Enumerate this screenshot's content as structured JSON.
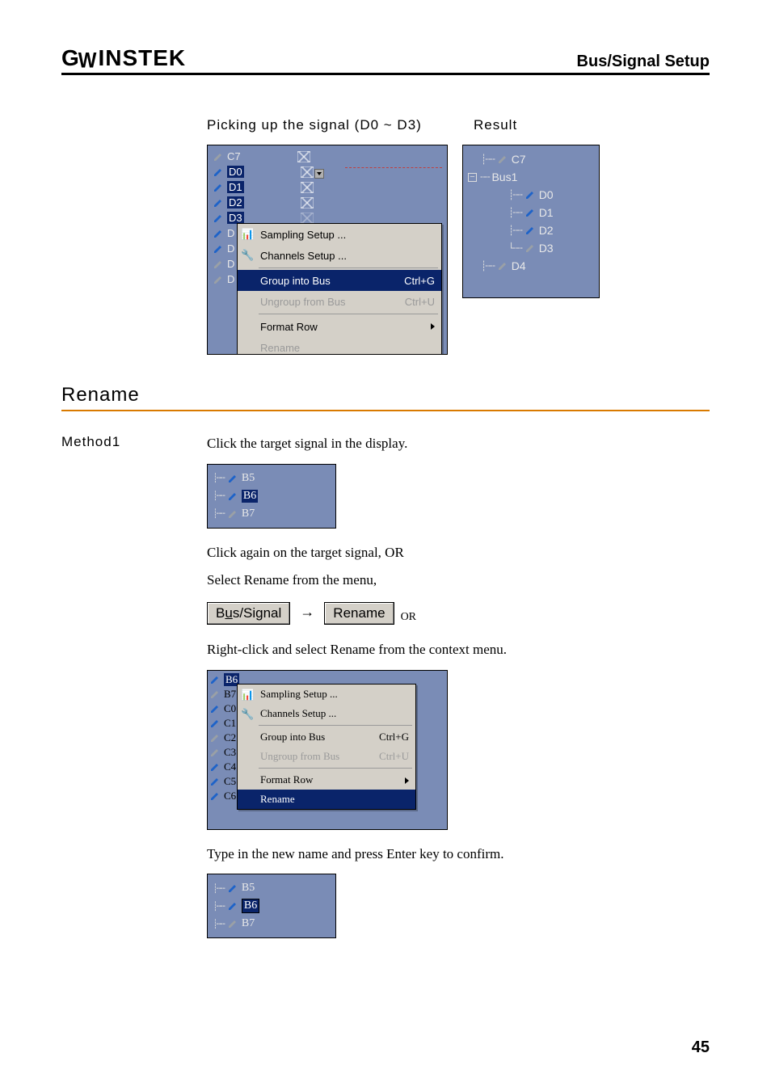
{
  "header": {
    "brand_prefix": "G",
    "brand_suffix": "INSTEK",
    "brand_sym": "W",
    "section": "Bus/Signal Setup"
  },
  "fig1": {
    "caption_left": "Picking up the signal (D0 ~ D3)",
    "caption_right": "Result",
    "signals_left": [
      "C7",
      "D0",
      "D1",
      "D2",
      "D3",
      "D",
      "D",
      "D",
      "D"
    ],
    "ctx": {
      "sampling": "Sampling Setup ...",
      "channels": "Channels Setup ...",
      "group": "Group into Bus",
      "group_sc": "Ctrl+G",
      "ungroup": "Ungroup from Bus",
      "ungroup_sc": "Ctrl+U",
      "format": "Format Row",
      "rename": "Rename"
    },
    "tree": {
      "top": "C7",
      "bus": "Bus1",
      "children": [
        "D0",
        "D1",
        "D2",
        "D3"
      ],
      "after": "D4"
    }
  },
  "section_title": "Rename",
  "method_label": "Method1",
  "steps": {
    "s1": "Click the target signal in the display.",
    "mini1": [
      "B5",
      "B6",
      "B7"
    ],
    "s2": "Click again on the target signal, OR",
    "s3": "Select Rename from the menu,",
    "btn_bus": "Bus/Signal",
    "btn_bus_ul": "u",
    "btn_rename": "Rename",
    "or": "OR",
    "s4": "Right-click and select Rename from the context menu.",
    "ctxC_signals": [
      "B6",
      "B7",
      "C0",
      "C1",
      "C2",
      "C3",
      "C4",
      "C5",
      "C6"
    ],
    "s5": "Type in the new name and press Enter key to confirm.",
    "mini2": [
      "B5",
      "B6",
      "B7"
    ]
  },
  "page_number": "45"
}
